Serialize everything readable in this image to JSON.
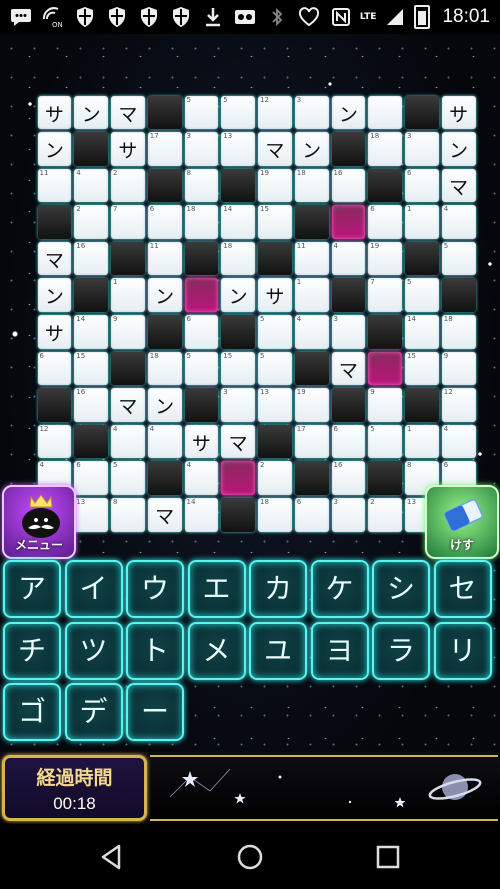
{
  "status_bar": {
    "time": "18:01",
    "network_label": "LTE",
    "icons": [
      "chat-icon",
      "wifi-calling-on-icon",
      "shield-icon",
      "shield-icon",
      "shield-icon",
      "shield-icon",
      "download-icon",
      "voicemail-icon",
      "bluetooth-icon",
      "heart-icon",
      "signal-icon",
      "battery-icon"
    ],
    "wifi_on_label": "ON"
  },
  "board": {
    "rows": 13,
    "cols": 12,
    "cells": [
      [
        {
          "c": "サ"
        },
        {
          "c": "ン"
        },
        {
          "c": "マ"
        },
        {
          "b": 1
        },
        {
          "n": "5"
        },
        {
          "n": "5"
        },
        {
          "n": "12"
        },
        {
          "n": "3"
        },
        {
          "c": "ン"
        },
        {},
        {
          "b": 1
        },
        {
          "c": "サ"
        }
      ],
      [
        {
          "c": "ン"
        },
        {
          "b": 1
        },
        {
          "c": "サ"
        },
        {
          "n": "17"
        },
        {
          "n": "3"
        },
        {
          "n": "13"
        },
        {
          "c": "マ"
        },
        {
          "c": "ン"
        },
        {
          "b": 1
        },
        {
          "n": "18"
        },
        {
          "n": "3"
        },
        {
          "c": "ン"
        }
      ],
      [
        {
          "n": "11"
        },
        {
          "n": "4"
        },
        {
          "n": "2"
        },
        {
          "b": 1
        },
        {
          "n": "8"
        },
        {
          "b": 1
        },
        {
          "n": "19"
        },
        {
          "n": "18"
        },
        {
          "n": "16"
        },
        {
          "b": 1
        },
        {
          "n": "6"
        },
        {
          "c": "マ"
        }
      ],
      [
        {
          "b": 1
        },
        {
          "n": "2"
        },
        {
          "n": "7"
        },
        {
          "n": "6"
        },
        {
          "n": "18"
        },
        {
          "n": "14"
        },
        {
          "n": "15"
        },
        {
          "b": 1
        },
        {
          "s": 1,
          "n": "10"
        },
        {
          "n": "6"
        },
        {
          "n": "1"
        },
        {
          "n": "4"
        }
      ],
      [
        {
          "c": "マ"
        },
        {
          "n": "16"
        },
        {
          "b": 1
        },
        {
          "n": "11"
        },
        {
          "b": 1
        },
        {
          "n": "18"
        },
        {
          "b": 1
        },
        {
          "n": "11"
        },
        {
          "n": "4"
        },
        {
          "n": "19"
        },
        {
          "b": 1
        },
        {
          "n": "5"
        }
      ],
      [
        {
          "c": "ン"
        },
        {
          "b": 1
        },
        {
          "n": "1"
        },
        {
          "c": "ン"
        },
        {
          "s": 1,
          "n": "10"
        },
        {
          "c": "ン"
        },
        {
          "c": "サ"
        },
        {
          "n": "1"
        },
        {
          "b": 1
        },
        {
          "n": "7"
        },
        {
          "n": "5"
        },
        {
          "b": 1
        }
      ],
      [
        {
          "c": "サ"
        },
        {
          "n": "14"
        },
        {
          "n": "9"
        },
        {
          "b": 1
        },
        {
          "n": "6"
        },
        {
          "b": 1
        },
        {
          "n": "5"
        },
        {
          "n": "4"
        },
        {
          "n": "3"
        },
        {
          "b": 1
        },
        {
          "n": "14"
        },
        {
          "n": "18"
        }
      ],
      [
        {
          "n": "6"
        },
        {
          "n": "15"
        },
        {
          "b": 1
        },
        {
          "n": "18"
        },
        {
          "n": "5"
        },
        {
          "n": "15"
        },
        {
          "n": "5"
        },
        {
          "b": 1
        },
        {
          "c": "マ"
        },
        {
          "s": 1,
          "n": "10"
        },
        {
          "n": "15"
        },
        {
          "n": "9"
        }
      ],
      [
        {
          "b": 1
        },
        {
          "n": "16"
        },
        {
          "c": "マ"
        },
        {
          "c": "ン"
        },
        {
          "b": 1
        },
        {
          "n": "3"
        },
        {
          "n": "13"
        },
        {
          "n": "19"
        },
        {
          "b": 1
        },
        {
          "n": "9"
        },
        {
          "b": 1
        },
        {
          "n": "12"
        }
      ],
      [
        {
          "n": "12"
        },
        {
          "b": 1
        },
        {
          "n": "4"
        },
        {
          "n": "4"
        },
        {
          "c": "サ"
        },
        {
          "c": "マ"
        },
        {
          "b": 1
        },
        {
          "n": "17"
        },
        {
          "n": "6"
        },
        {
          "n": "5"
        },
        {
          "n": "1"
        },
        {
          "n": "4"
        }
      ],
      [
        {
          "n": "4"
        },
        {
          "n": "6"
        },
        {
          "n": "5"
        },
        {
          "b": 1
        },
        {
          "n": "4"
        },
        {
          "s": 1,
          "n": "10"
        },
        {
          "n": "2"
        },
        {
          "b": 1
        },
        {
          "n": "16"
        },
        {
          "b": 1
        },
        {
          "n": "8"
        },
        {
          "n": "6"
        }
      ],
      [
        {
          "n": "8"
        },
        {
          "n": "13"
        },
        {
          "n": "8"
        },
        {
          "c": "マ"
        },
        {
          "n": "14"
        },
        {
          "b": 1
        },
        {
          "n": "18"
        },
        {
          "n": "6"
        },
        {
          "n": "3"
        },
        {
          "n": "2"
        },
        {
          "n": "13"
        },
        {
          "n": "13"
        }
      ]
    ]
  },
  "menu_button": {
    "label": "メニュー",
    "icon": "mustache-king-icon"
  },
  "erase_button": {
    "label": "けす",
    "icon": "eraser-icon"
  },
  "keyboard": {
    "rows": [
      [
        "ア",
        "イ",
        "ウ",
        "エ",
        "カ",
        "ケ",
        "シ",
        "セ"
      ],
      [
        "チ",
        "ツ",
        "ト",
        "メ",
        "ユ",
        "ヨ",
        "ラ",
        "リ"
      ],
      [
        "ゴ",
        "デ",
        "ー"
      ]
    ]
  },
  "timer": {
    "title": "経過時間",
    "value": "00:18"
  },
  "nav_bar": {
    "icons": [
      "back-icon",
      "home-icon",
      "recents-icon"
    ]
  },
  "colors": {
    "selected_cell": "#b9167c",
    "key_glow": "#5ff3ee",
    "timer_border": "#d8b54a"
  }
}
